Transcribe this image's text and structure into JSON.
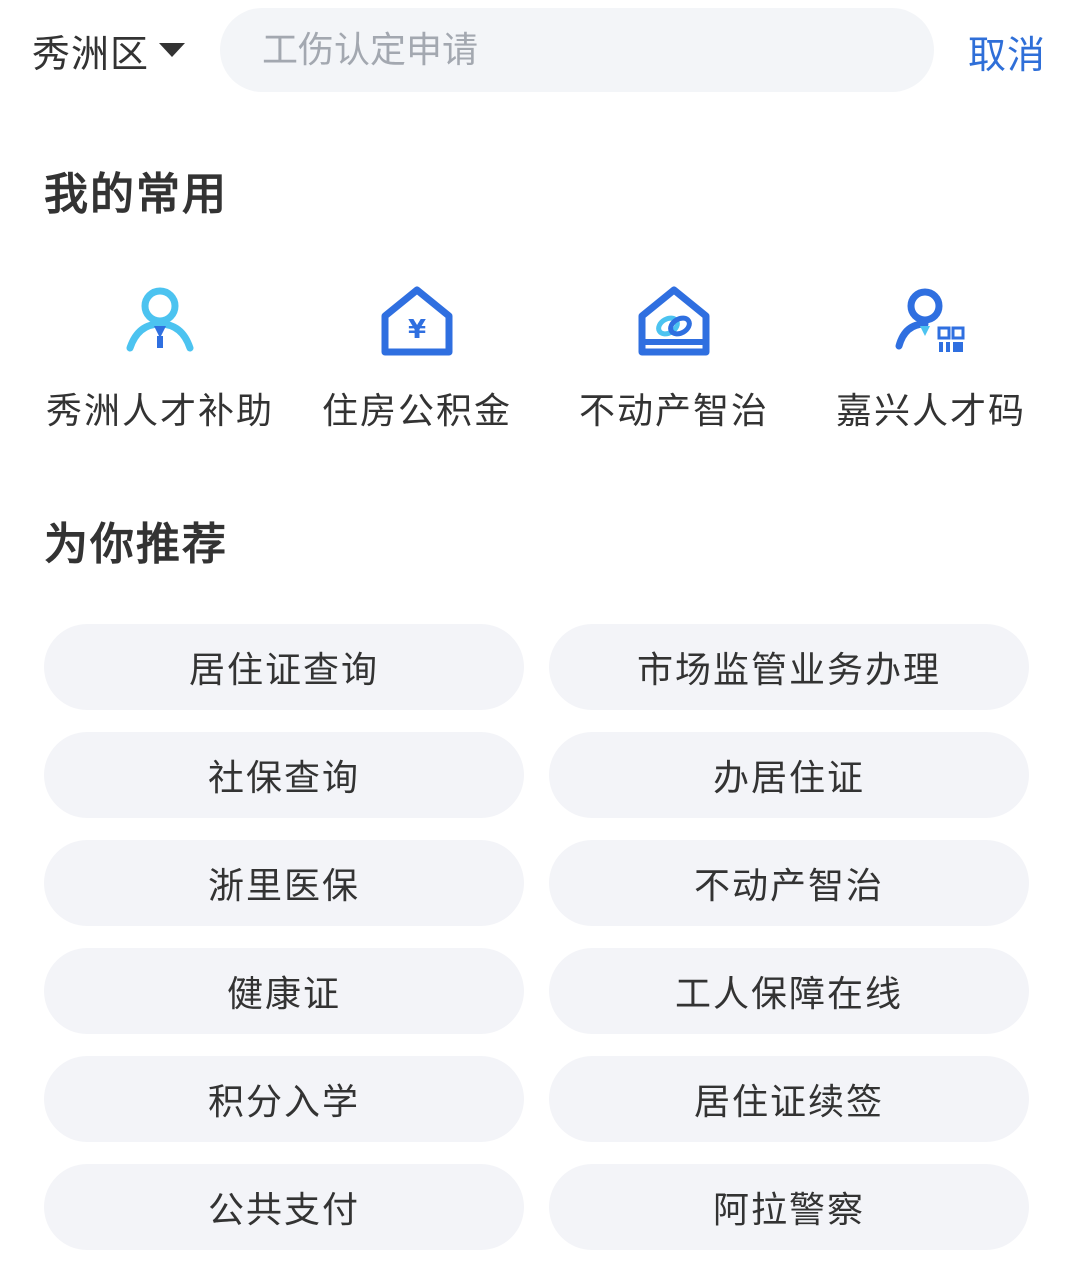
{
  "header": {
    "region": "秀洲区",
    "search_placeholder": "工伤认定申请",
    "cancel_label": "取消"
  },
  "favorites": {
    "title": "我的常用",
    "items": [
      {
        "label": "秀洲人才补助",
        "icon": "talent-person-icon"
      },
      {
        "label": "住房公积金",
        "icon": "housing-fund-icon"
      },
      {
        "label": "不动产智治",
        "icon": "real-estate-icon"
      },
      {
        "label": "嘉兴人才码",
        "icon": "talent-code-icon"
      }
    ]
  },
  "recommend": {
    "title": "为你推荐",
    "items": [
      "居住证查询",
      "市场监管业务办理",
      "社保查询",
      "办居住证",
      "浙里医保",
      "不动产智治",
      "健康证",
      "工人保障在线",
      "积分入学",
      "居住证续签",
      "公共支付",
      "阿拉警察"
    ]
  },
  "colors": {
    "accent": "#2f6fd8",
    "icon_blue": "#2f6fe0",
    "icon_cyan": "#4cc3f0",
    "chip_bg": "#f3f4f8"
  }
}
